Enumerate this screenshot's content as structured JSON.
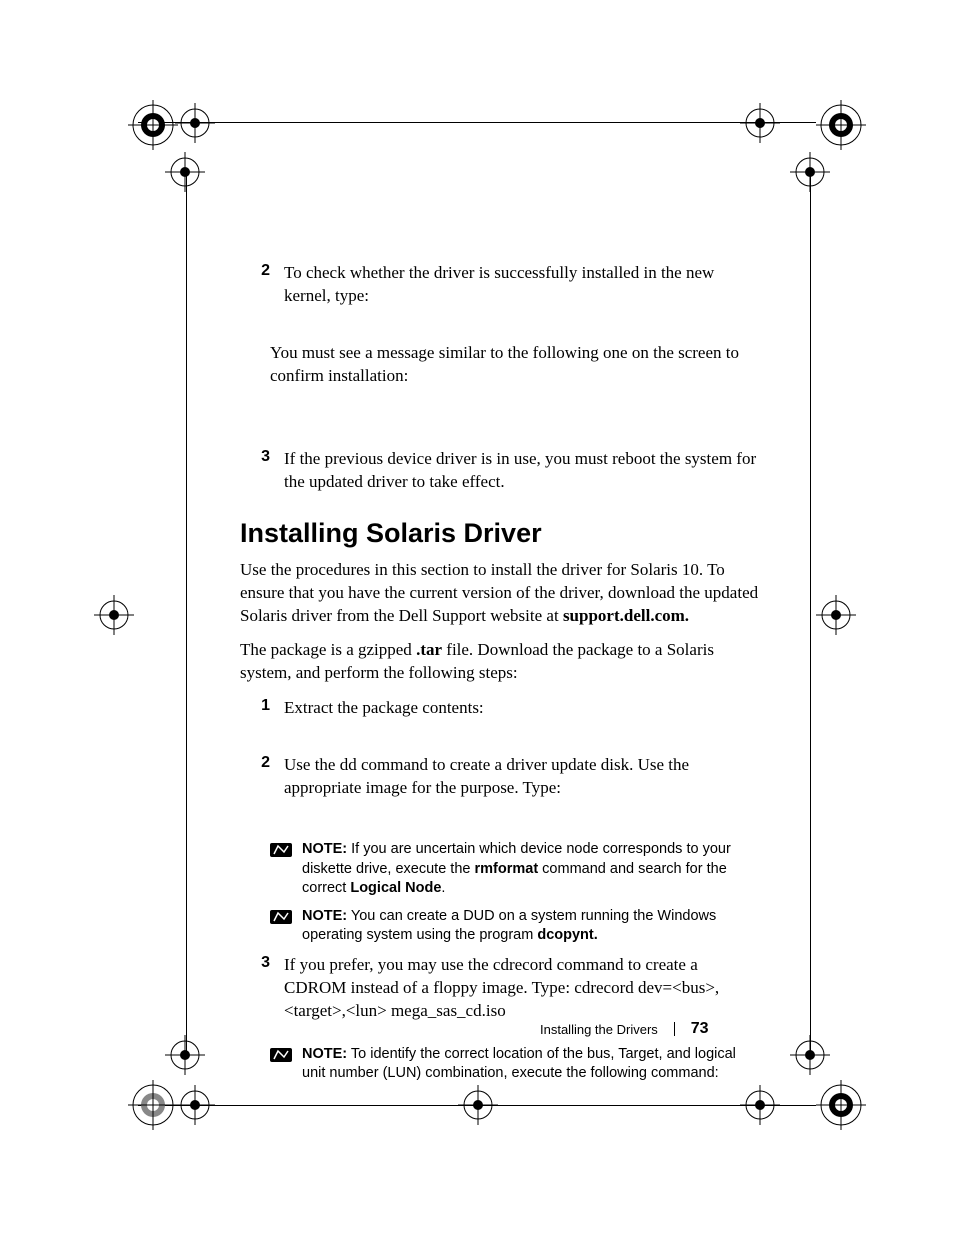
{
  "preSteps": {
    "step2": {
      "num": "2",
      "line1": "To check whether the driver is successfully installed in the new kernel, type:",
      "line2": "You must see a message similar to the following one on the screen to confirm installation:"
    },
    "step3": {
      "num": "3",
      "line1": "If the previous device driver is in use, you must reboot the system for the updated driver to take effect."
    }
  },
  "section": {
    "title": "Installing Solaris Driver",
    "p1_a": "Use the procedures in this section to install the driver for Solaris 10. To ensure that you have the current version of the driver, download the updated Solaris driver from the Dell Support website at ",
    "p1_b": "support.dell.com.",
    "p2_a": "The package is a gzipped ",
    "p2_b": ".tar",
    "p2_c": " file. Download the package to a Solaris system, and perform the following steps:"
  },
  "steps": {
    "s1": {
      "num": "1",
      "text": "Extract the package contents:"
    },
    "s2": {
      "num": "2",
      "text": "Use the dd command to create a driver update disk. Use the appropriate image for the purpose. Type:"
    },
    "s3": {
      "num": "3",
      "text": "If you prefer, you may use the cdrecord command to create a CDROM instead of a floppy image. Type: cdrecord dev=<bus>,<target>,<lun> mega_sas_cd.iso"
    }
  },
  "notes": {
    "n1": {
      "lead": "NOTE:",
      "a": " If you are uncertain which device node corresponds to your diskette drive, execute the ",
      "b": "rmformat",
      "c": "  command and search for the correct ",
      "d": "Logical Node",
      "e": "."
    },
    "n2": {
      "lead": "NOTE:",
      "a": " You can create a DUD on a system running the Windows operating system using the program ",
      "b": "dcopynt."
    },
    "n3": {
      "lead": "NOTE:",
      "a": " To identify the correct location of the bus, Target, and logical unit number (LUN) combination, execute the following command:"
    }
  },
  "footer": {
    "title": "Installing the Drivers",
    "page": "73"
  },
  "icons": {
    "note": "note-pencil-icon"
  }
}
